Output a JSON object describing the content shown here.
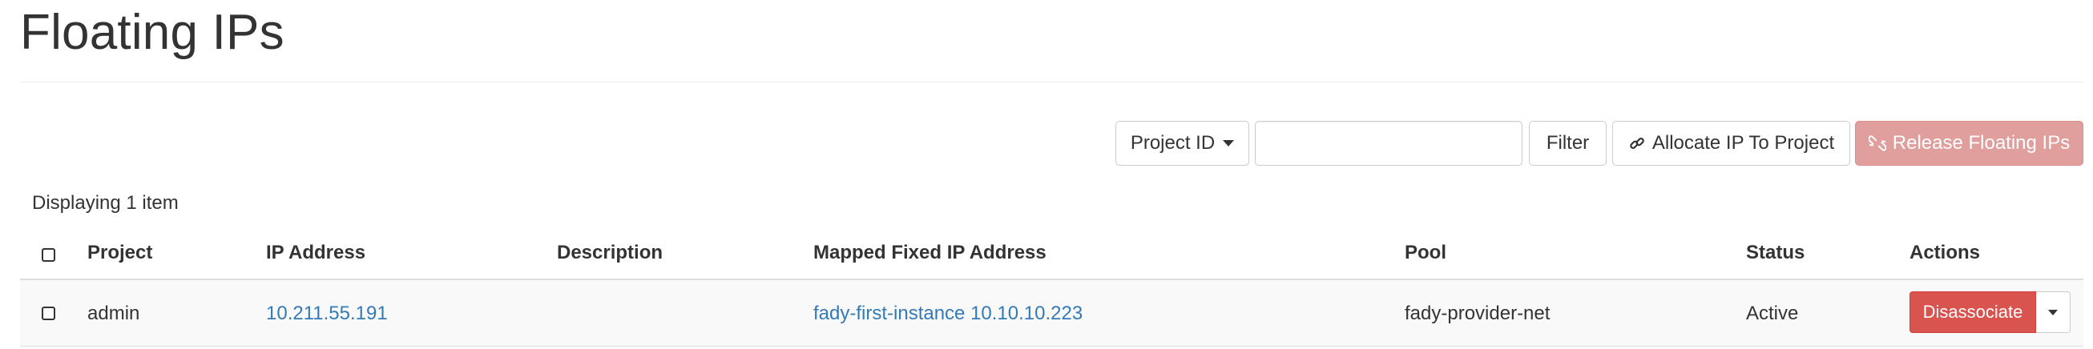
{
  "page": {
    "title": "Floating IPs"
  },
  "toolbar": {
    "filter_field_label": "Project ID",
    "filter_value": "",
    "filter_button": "Filter",
    "allocate_button": "Allocate IP To Project",
    "release_button": "Release Floating IPs"
  },
  "table": {
    "count_text": "Displaying 1 item",
    "columns": {
      "project": "Project",
      "ip_address": "IP Address",
      "description": "Description",
      "mapped_fixed_ip": "Mapped Fixed IP Address",
      "pool": "Pool",
      "status": "Status",
      "actions": "Actions"
    },
    "rows": [
      {
        "project": "admin",
        "ip_address": "10.211.55.191",
        "description": "",
        "mapped_fixed_ip": "fady-first-instance 10.10.10.223",
        "pool": "fady-provider-net",
        "status": "Active",
        "action": "Disassociate"
      }
    ]
  },
  "colors": {
    "link": "#337ab7",
    "danger": "#d9534f",
    "danger_disabled": "#e09e9d",
    "row_stripe": "#f9f9f9"
  },
  "icons": {
    "allocate": "link-icon",
    "release": "unlink-icon",
    "dropdown": "caret-down-icon"
  }
}
